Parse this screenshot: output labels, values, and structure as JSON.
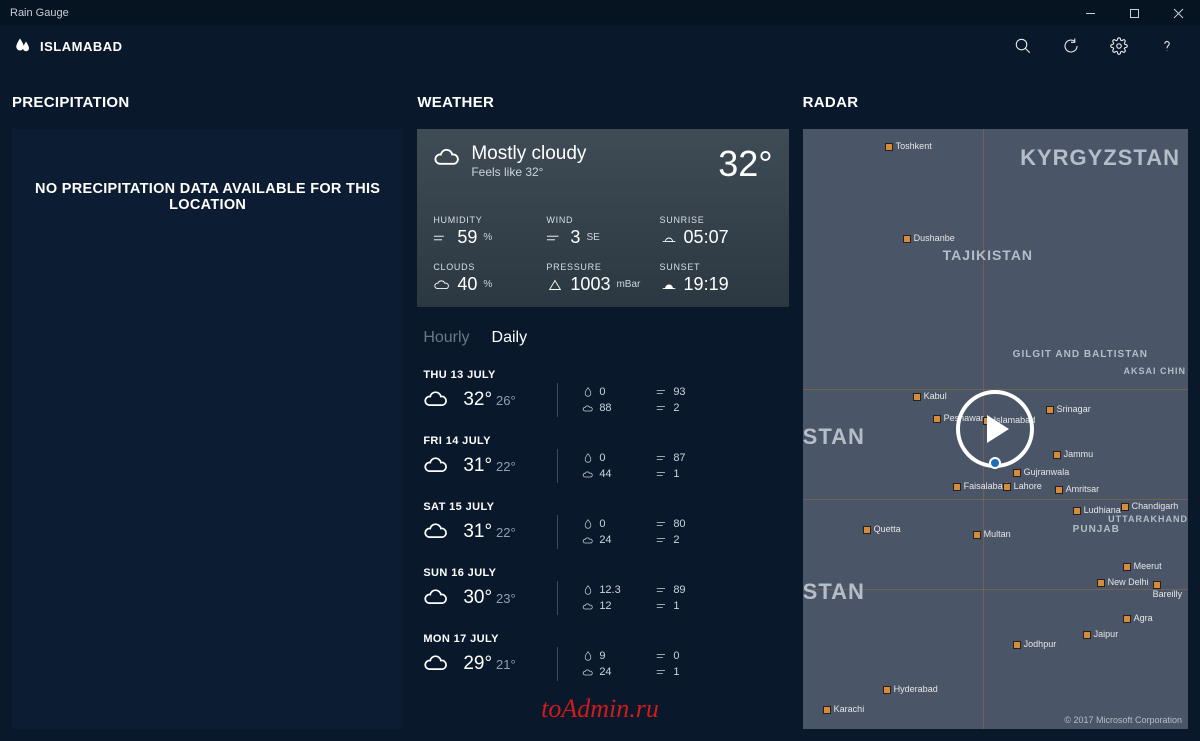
{
  "window": {
    "title": "Rain Gauge"
  },
  "header": {
    "location": "ISLAMABAD"
  },
  "sections": {
    "precip": "PRECIPITATION",
    "weather": "WEATHER",
    "radar": "RADAR"
  },
  "precip": {
    "empty": "NO PRECIPITATION DATA AVAILABLE FOR THIS LOCATION"
  },
  "current": {
    "condition": "Mostly cloudy",
    "feels_like": "Feels like 32°",
    "temp": "32°",
    "humidity_label": "HUMIDITY",
    "humidity": "59",
    "humidity_unit": "%",
    "wind_label": "WIND",
    "wind": "3",
    "wind_unit": "SE",
    "sunrise_label": "SUNRISE",
    "sunrise": "05:07",
    "clouds_label": "CLOUDS",
    "clouds": "40",
    "clouds_unit": "%",
    "pressure_label": "PRESSURE",
    "pressure": "1003",
    "pressure_unit": "mBar",
    "sunset_label": "SUNSET",
    "sunset": "19:19"
  },
  "tabs": {
    "hourly": "Hourly",
    "daily": "Daily",
    "active": "daily"
  },
  "forecast": [
    {
      "date": "THU 13 JULY",
      "hi": "32°",
      "lo": "26°",
      "precip": "0",
      "cloud": "88",
      "wind": "93",
      "gust": "2"
    },
    {
      "date": "FRI 14 JULY",
      "hi": "31°",
      "lo": "22°",
      "precip": "0",
      "cloud": "44",
      "wind": "87",
      "gust": "1"
    },
    {
      "date": "SAT 15 JULY",
      "hi": "31°",
      "lo": "22°",
      "precip": "0",
      "cloud": "24",
      "wind": "80",
      "gust": "2"
    },
    {
      "date": "SUN 16 JULY",
      "hi": "30°",
      "lo": "23°",
      "precip": "12.3",
      "cloud": "12",
      "wind": "89",
      "gust": "1"
    },
    {
      "date": "MON 17 JULY",
      "hi": "29°",
      "lo": "21°",
      "precip": "9",
      "cloud": "24",
      "wind": "0",
      "gust": "1"
    }
  ],
  "map": {
    "countries": [
      "KYRGYZSTAN",
      "TAJIKISTAN",
      "GILGIT AND BALTISTAN",
      "PUNJAB",
      "UTTARAKHAND",
      "AKSAI CHIN"
    ],
    "partial": [
      "STAN",
      "STAN"
    ],
    "cities": [
      "Toshkent",
      "Dushanbe",
      "Kabul",
      "Peshawar",
      "Islamabad",
      "Srinagar",
      "Jammu",
      "Faisalabad",
      "Lahore",
      "Gujranwala",
      "Amritsar",
      "Ludhiana",
      "Chandigarh",
      "Quetta",
      "Multan",
      "Meerut",
      "New Delhi",
      "Bareilly",
      "Agra",
      "Jaipur",
      "Jodhpur",
      "Hyderabad",
      "Karachi"
    ],
    "attribution": "© 2017 Microsoft Corporation"
  },
  "watermark": "toAdmin.ru"
}
